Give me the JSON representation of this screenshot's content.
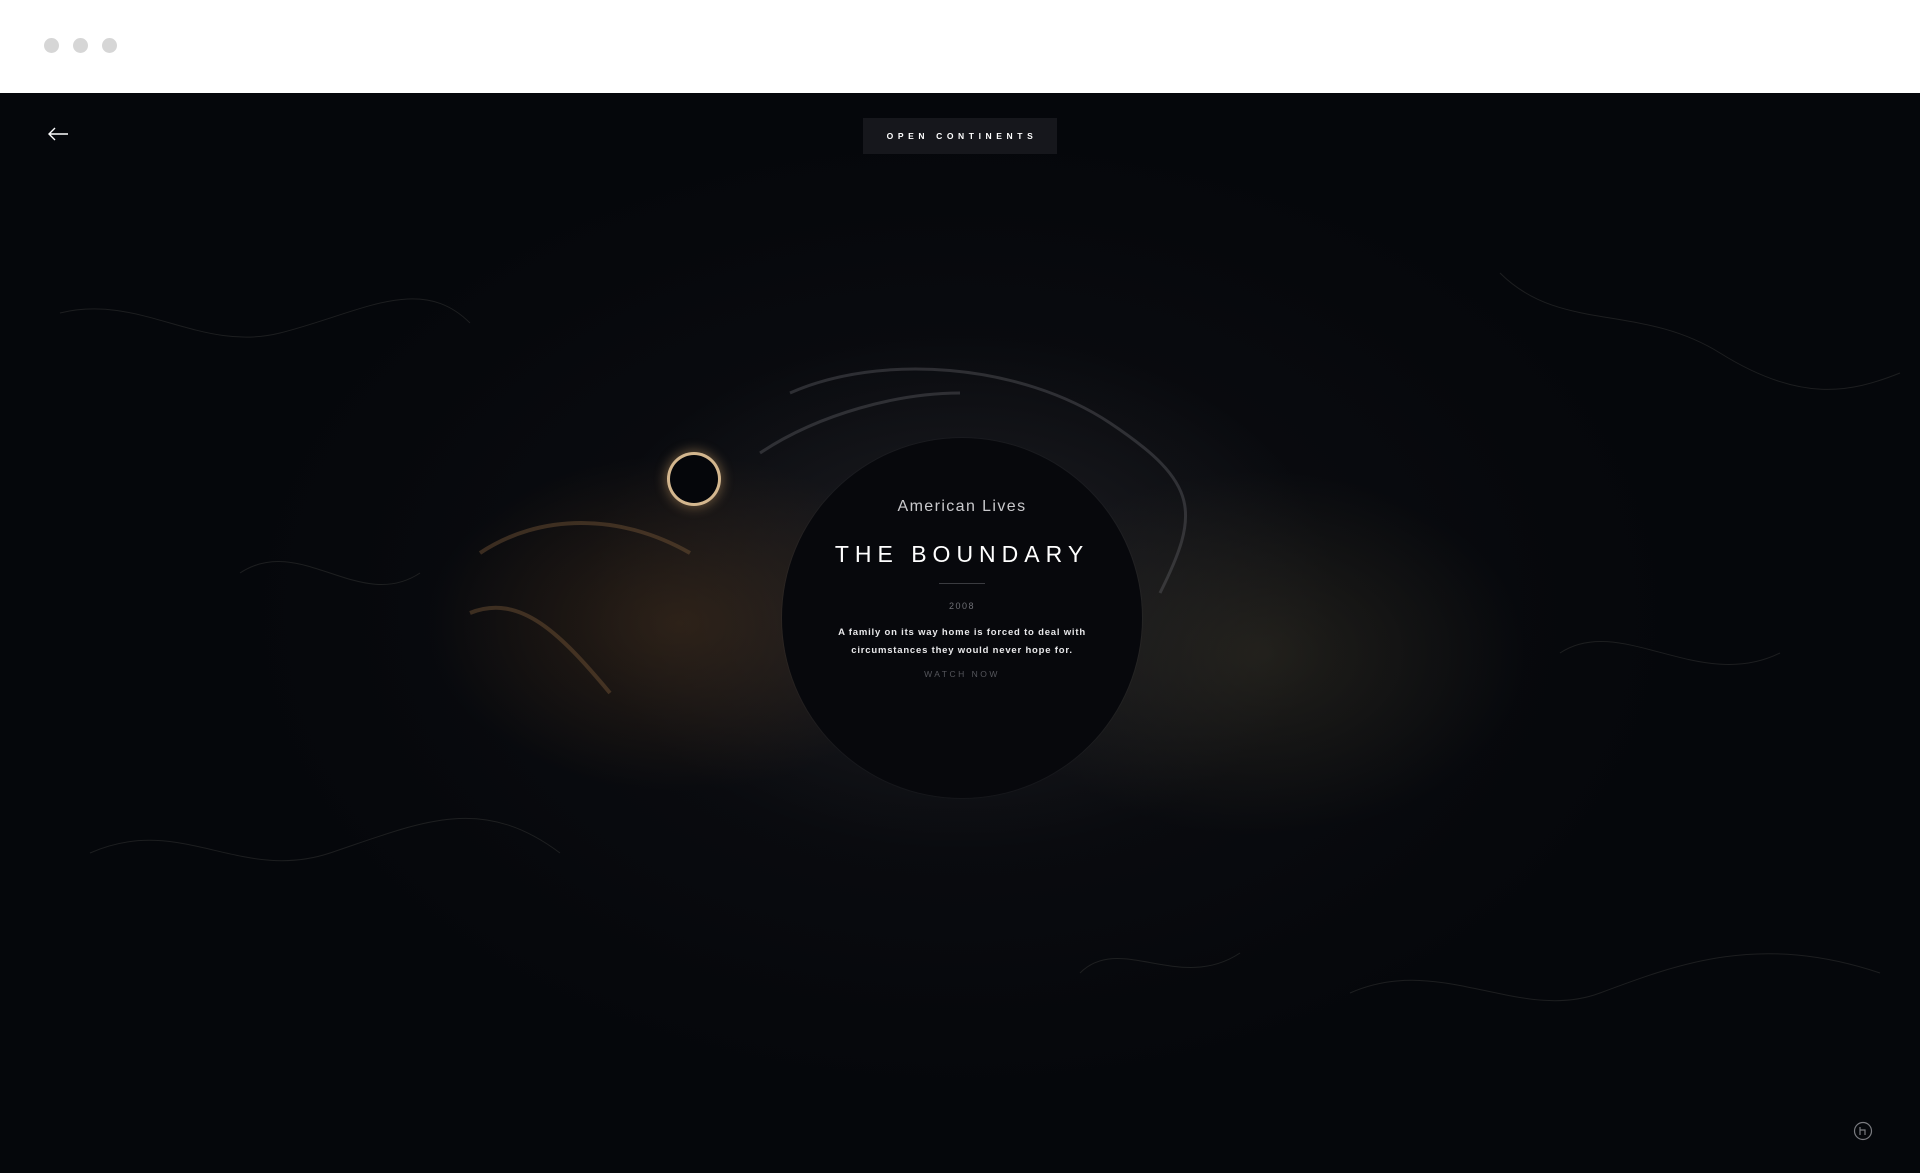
{
  "browser": {
    "traffic_light_color": "#d6d6d6"
  },
  "header": {
    "back_icon": "arrow-left-icon",
    "nav_label": "OPEN CONTINENTS"
  },
  "story": {
    "series": "American Lives",
    "title": "THE BOUNDARY",
    "year": "2008",
    "description": "A family on its way home is forced to deal with circumstances they would never hope for.",
    "cta": "WATCH NOW"
  },
  "footer": {
    "badge_icon": "circle-logo-icon"
  },
  "colors": {
    "background": "#05070b",
    "accent_glow": "#ecc da0",
    "text": "#ffffff"
  }
}
